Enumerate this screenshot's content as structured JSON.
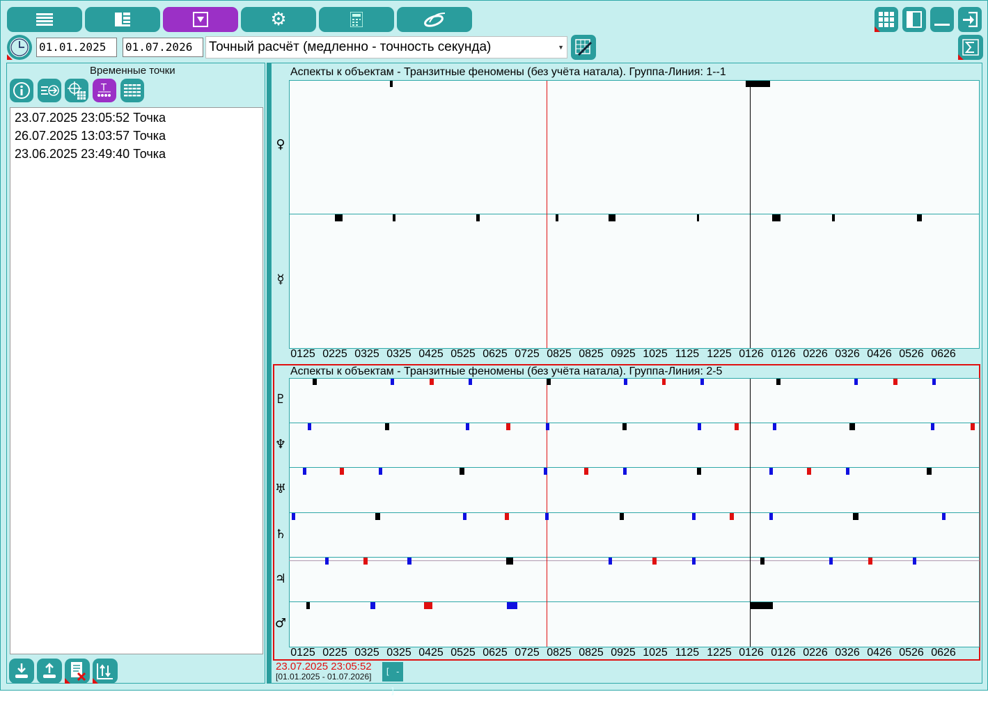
{
  "toolbar": {
    "buttons": [
      {
        "icon": "list-icon",
        "active": false
      },
      {
        "icon": "layout-icon",
        "active": false
      },
      {
        "icon": "filter-icon",
        "active": true
      },
      {
        "icon": "gear-icon",
        "active": false
      },
      {
        "icon": "calculator-icon",
        "active": false
      },
      {
        "icon": "logo-swirl-icon",
        "active": false
      }
    ],
    "right_buttons": [
      "grid-icon",
      "panel-icon",
      "minimize-icon",
      "exit-icon"
    ]
  },
  "controls": {
    "date_from": "01.01.2025",
    "date_to": "01.07.2026",
    "mode_select": "Точный расчёт (медленно - точность секунда)"
  },
  "left_panel": {
    "title": "Временные точки",
    "points": [
      "23.07.2025 23:05:52 Точка",
      "26.07.2025 13:03:57 Точка",
      "23.06.2025 23:49:40 Точка"
    ]
  },
  "chart1": {
    "title": "Аспекты к объектам - Транзитные феномены (без учёта натала). Группа-Линия: 1--1",
    "rows": [
      "♀",
      "☿"
    ]
  },
  "chart2": {
    "title": "Аспекты к объектам - Транзитные феномены (без учёта натала). Группа-Линия: 2-5",
    "rows": [
      "♇",
      "♆",
      "♅",
      "♄",
      "♃",
      "♂"
    ]
  },
  "x_ticks": [
    "0125",
    "0225",
    "0325",
    "0325",
    "0425",
    "0525",
    "0625",
    "0725",
    "0825",
    "0825",
    "0925",
    "1025",
    "1125",
    "1225",
    "0126",
    "0126",
    "0226",
    "0326",
    "0426",
    "0526",
    "0626"
  ],
  "status": {
    "current_time": "23.07.2025 23:05:52",
    "range": "[01.01.2025 - 01.07.2026]",
    "collapse_label": "[ - ]"
  },
  "colors": {
    "teal": "#2a9d9d",
    "active": "#9b30c6",
    "marker_black": "#000000",
    "marker_blue": "#1010e0",
    "marker_red": "#e01010",
    "cursor_line": "#e01010"
  }
}
